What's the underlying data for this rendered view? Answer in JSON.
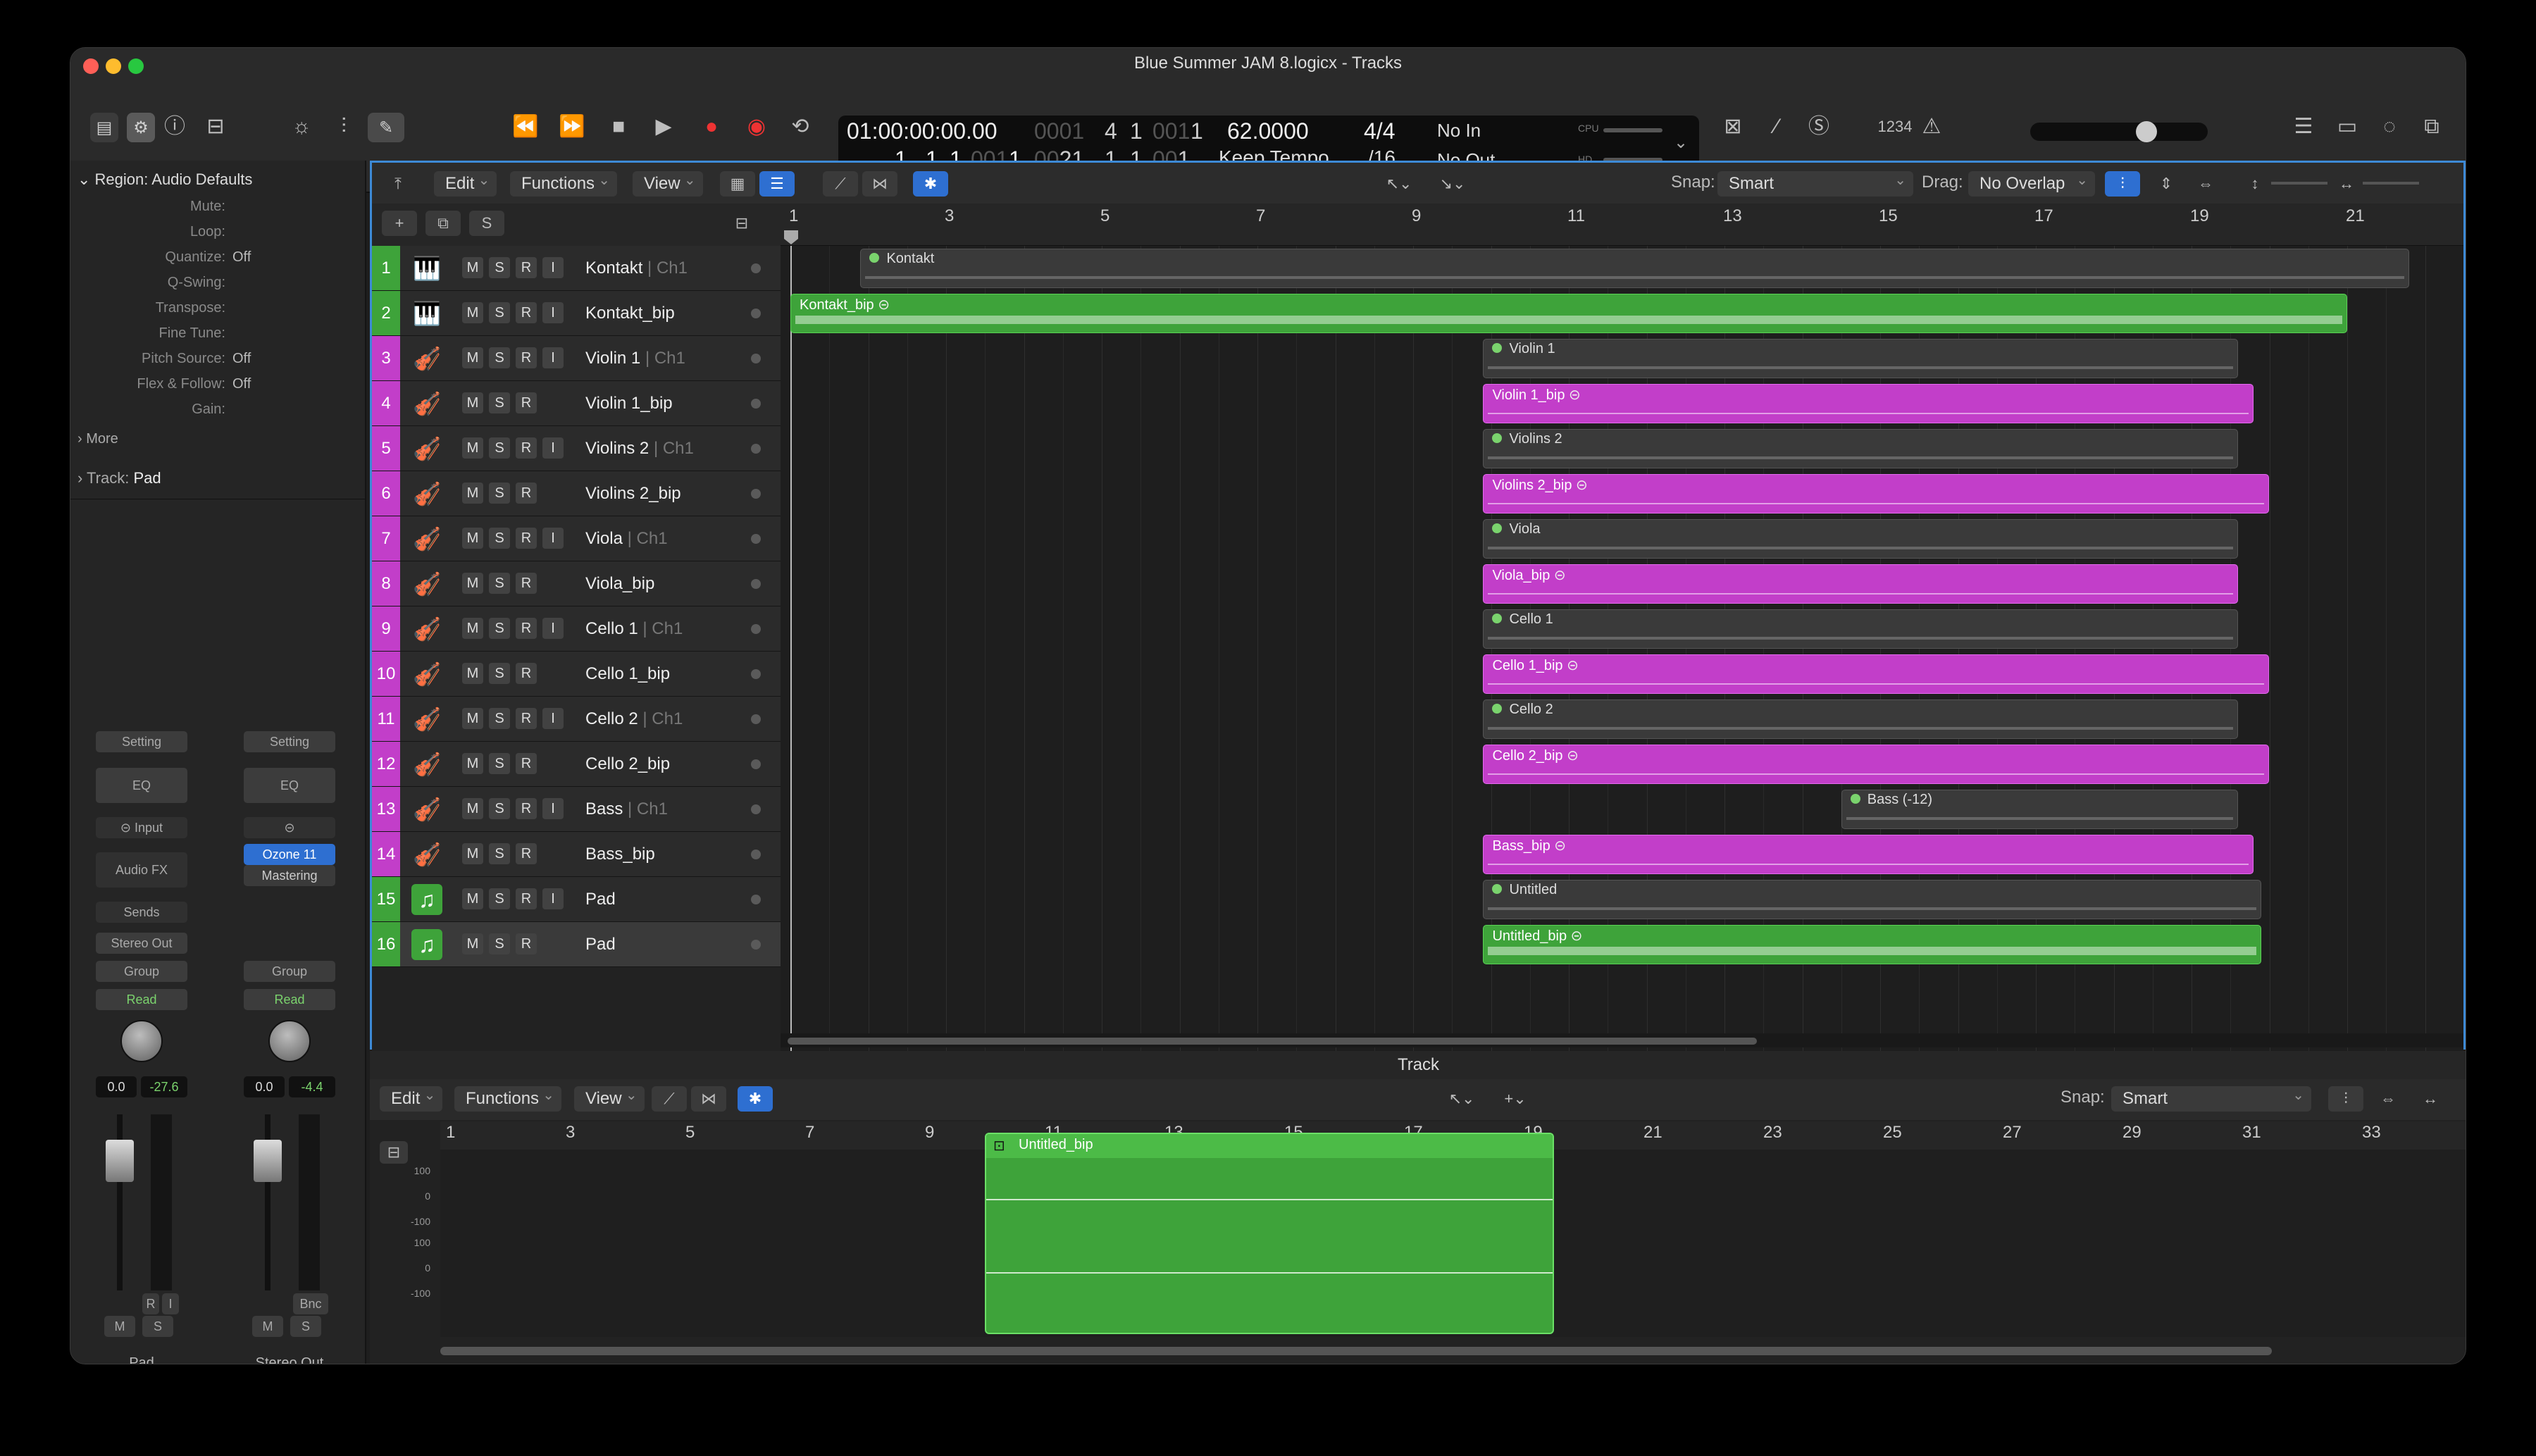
{
  "window": {
    "title": "Blue Summer JAM 8.logicx - Tracks"
  },
  "lcd": {
    "smpte": "01:00:00:00.00",
    "bars_top_dim": "0001",
    "beat_top": "4",
    "div_top": "1",
    "tick_top_dim": "001",
    "tick_top": "1",
    "bars_bot": "1",
    "beat_bot": "1",
    "div_bot": "1",
    "tick_bot_dim": "001",
    "tick_bot": "1",
    "lbar_dim": "00",
    "lbar": "21",
    "lbeat": "1",
    "ldiv": "1",
    "ltick_dim": "00",
    "ltick": "1",
    "tempo": "62.0000",
    "tempo_mode": "Keep Tempo",
    "sig": "4/4",
    "div": "/16",
    "in": "No In",
    "out": "No Out",
    "cpu": "CPU",
    "hd": "HD"
  },
  "toolbar": {
    "count_in": "1234"
  },
  "inspector": {
    "region_header": "Region: Audio Defaults",
    "params": [
      {
        "label": "Mute:",
        "value": ""
      },
      {
        "label": "Loop:",
        "value": ""
      },
      {
        "label": "Quantize:",
        "value": "Off"
      },
      {
        "label": "Q-Swing:",
        "value": ""
      },
      {
        "label": "Transpose:",
        "value": ""
      },
      {
        "label": "Fine Tune:",
        "value": ""
      },
      {
        "label": "Pitch Source:",
        "value": "Off"
      },
      {
        "label": "Flex & Follow:",
        "value": "Off"
      },
      {
        "label": "Gain:",
        "value": ""
      }
    ],
    "more": "More",
    "track_header": "Track:",
    "track_name": "Pad",
    "strip1": {
      "setting": "Setting",
      "eq": "EQ",
      "input": "Input",
      "audiofx": "Audio FX",
      "sends": "Sends",
      "output": "Stereo Out",
      "group": "Group",
      "read": "Read",
      "vol": "0.0",
      "peak": "-27.6",
      "r": "R",
      "i": "I",
      "m": "M",
      "s": "S",
      "name": "Pad"
    },
    "strip2": {
      "setting": "Setting",
      "eq": "EQ",
      "plugin1": "Ozone 11",
      "plugin2": "Mastering",
      "group": "Group",
      "read": "Read",
      "vol": "0.0",
      "peak": "-4.4",
      "bnc": "Bnc",
      "m": "M",
      "s": "S",
      "name": "Stereo Out"
    }
  },
  "tracks_toolbar": {
    "edit": "Edit",
    "functions": "Functions",
    "view": "View",
    "snap_label": "Snap:",
    "snap": "Smart",
    "drag_label": "Drag:",
    "drag": "No Overlap",
    "s": "S"
  },
  "ruler": [
    "1",
    "3",
    "5",
    "7",
    "9",
    "11",
    "13",
    "15",
    "17",
    "19",
    "21"
  ],
  "tracks": [
    {
      "num": "1",
      "name": "Kontakt",
      "sub": " | Ch1",
      "color": "#3ea33a",
      "icon": "🎹",
      "btns": [
        "M",
        "S",
        "R",
        "I"
      ]
    },
    {
      "num": "2",
      "name": "Kontakt_bip",
      "sub": "",
      "color": "#3ea33a",
      "icon": "🎹",
      "btns": [
        "M",
        "S",
        "R",
        "I"
      ]
    },
    {
      "num": "3",
      "name": "Violin 1",
      "sub": " | Ch1",
      "color": "#c23ec9",
      "icon": "🎻",
      "btns": [
        "M",
        "S",
        "R",
        "I"
      ]
    },
    {
      "num": "4",
      "name": "Violin 1_bip",
      "sub": "",
      "color": "#c23ec9",
      "icon": "🎻",
      "btns": [
        "M",
        "S",
        "R"
      ]
    },
    {
      "num": "5",
      "name": "Violins 2",
      "sub": " | Ch1",
      "color": "#c23ec9",
      "icon": "🎻",
      "btns": [
        "M",
        "S",
        "R",
        "I"
      ]
    },
    {
      "num": "6",
      "name": "Violins 2_bip",
      "sub": "",
      "color": "#c23ec9",
      "icon": "🎻",
      "btns": [
        "M",
        "S",
        "R"
      ]
    },
    {
      "num": "7",
      "name": "Viola",
      "sub": " | Ch1",
      "color": "#c23ec9",
      "icon": "🎻",
      "btns": [
        "M",
        "S",
        "R",
        "I"
      ]
    },
    {
      "num": "8",
      "name": "Viola_bip",
      "sub": "",
      "color": "#c23ec9",
      "icon": "🎻",
      "btns": [
        "M",
        "S",
        "R"
      ]
    },
    {
      "num": "9",
      "name": "Cello 1",
      "sub": " | Ch1",
      "color": "#c23ec9",
      "icon": "🎻",
      "btns": [
        "M",
        "S",
        "R",
        "I"
      ]
    },
    {
      "num": "10",
      "name": "Cello 1_bip",
      "sub": "",
      "color": "#c23ec9",
      "icon": "🎻",
      "btns": [
        "M",
        "S",
        "R"
      ]
    },
    {
      "num": "11",
      "name": "Cello 2",
      "sub": " | Ch1",
      "color": "#c23ec9",
      "icon": "🎻",
      "btns": [
        "M",
        "S",
        "R",
        "I"
      ]
    },
    {
      "num": "12",
      "name": "Cello 2_bip",
      "sub": "",
      "color": "#c23ec9",
      "icon": "🎻",
      "btns": [
        "M",
        "S",
        "R"
      ]
    },
    {
      "num": "13",
      "name": "Bass",
      "sub": " | Ch1",
      "color": "#c23ec9",
      "icon": "🎻",
      "btns": [
        "M",
        "S",
        "R",
        "I"
      ]
    },
    {
      "num": "14",
      "name": "Bass_bip",
      "sub": "",
      "color": "#c23ec9",
      "icon": "🎻",
      "btns": [
        "M",
        "S",
        "R"
      ]
    },
    {
      "num": "15",
      "name": "Pad",
      "sub": "",
      "color": "#3ea33a",
      "icon": "♫",
      "btns": [
        "M",
        "S",
        "R",
        "I"
      ]
    },
    {
      "num": "16",
      "name": "Pad",
      "sub": "",
      "color": "#3ea33a",
      "icon": "♫",
      "btns": [
        "M",
        "S",
        "R"
      ]
    }
  ],
  "regions": [
    {
      "row": 0,
      "name": "Kontakt",
      "start": 1.9,
      "end": 21.8,
      "type": "rg"
    },
    {
      "row": 1,
      "name": "Kontakt_bip",
      "start": 1.0,
      "end": 21.0,
      "type": "rgr"
    },
    {
      "row": 2,
      "name": "Violin 1",
      "start": 9.9,
      "end": 19.6,
      "type": "rg"
    },
    {
      "row": 3,
      "name": "Violin 1_bip",
      "start": 9.9,
      "end": 19.8,
      "type": "rp"
    },
    {
      "row": 4,
      "name": "Violins 2",
      "start": 9.9,
      "end": 19.6,
      "type": "rg"
    },
    {
      "row": 5,
      "name": "Violins 2_bip",
      "start": 9.9,
      "end": 20.0,
      "type": "rp"
    },
    {
      "row": 6,
      "name": "Viola",
      "start": 9.9,
      "end": 19.6,
      "type": "rg"
    },
    {
      "row": 7,
      "name": "Viola_bip",
      "start": 9.9,
      "end": 19.6,
      "type": "rp"
    },
    {
      "row": 8,
      "name": "Cello 1",
      "start": 9.9,
      "end": 19.6,
      "type": "rg"
    },
    {
      "row": 9,
      "name": "Cello 1_bip",
      "start": 9.9,
      "end": 20.0,
      "type": "rp"
    },
    {
      "row": 10,
      "name": "Cello 2",
      "start": 9.9,
      "end": 19.6,
      "type": "rg"
    },
    {
      "row": 11,
      "name": "Cello 2_bip",
      "start": 9.9,
      "end": 20.0,
      "type": "rp"
    },
    {
      "row": 12,
      "name": "Bass (-12)",
      "start": 14.5,
      "end": 19.6,
      "type": "rg"
    },
    {
      "row": 13,
      "name": "Bass_bip",
      "start": 9.9,
      "end": 19.8,
      "type": "rp"
    },
    {
      "row": 14,
      "name": "Untitled",
      "start": 9.9,
      "end": 19.9,
      "type": "rg"
    },
    {
      "row": 15,
      "name": "Untitled_bip",
      "start": 9.9,
      "end": 19.9,
      "type": "rgr"
    }
  ],
  "editor": {
    "title": "Track",
    "edit": "Edit",
    "functions": "Functions",
    "view": "View",
    "snap_label": "Snap:",
    "snap": "Smart",
    "region": "Untitled_bip",
    "ruler": [
      "1",
      "3",
      "5",
      "7",
      "9",
      "11",
      "13",
      "15",
      "17",
      "19",
      "21",
      "23",
      "25",
      "27",
      "29",
      "31",
      "33"
    ],
    "scale": [
      "100",
      "0",
      "-100",
      "100",
      "0",
      "-100"
    ]
  }
}
